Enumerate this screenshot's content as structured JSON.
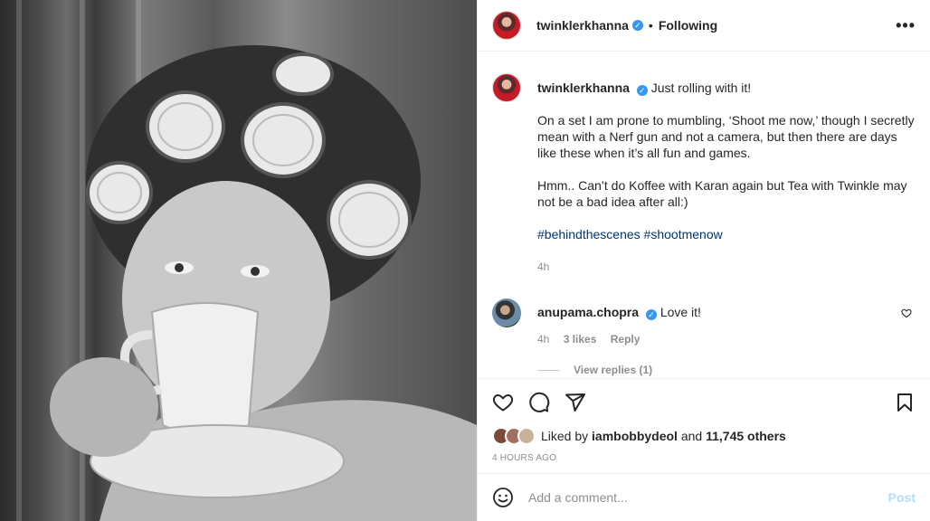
{
  "header": {
    "username": "twinklerkhanna",
    "verified_mark": "✓",
    "separator": "•",
    "follow_status": "Following",
    "more_icon": "more-horizontal-icon"
  },
  "caption": {
    "username": "twinklerkhanna",
    "verified_mark": "✓",
    "first_line": "Just rolling with it!",
    "paragraph_1": "On a set I am prone to mumbling, ‘Shoot me now,’ though I secretly mean with a Nerf gun and not a camera, but then there are days like these when it’s all fun and games.",
    "paragraph_2": "Hmm.. Can’t do Koffee with Karan again but Tea with Twinkle may not be a bad idea after all:)",
    "hashtags": [
      "#behindthescenes",
      "#shootmenow"
    ],
    "time": "4h"
  },
  "comment": {
    "username": "anupama.chopra",
    "verified_mark": "✓",
    "text": "Love it!",
    "time": "4h",
    "likes": "3 likes",
    "reply": "Reply",
    "view_replies": "View replies (1)"
  },
  "actions": {
    "like_icon": "heart-icon",
    "comment_icon": "comment-icon",
    "share_icon": "paper-plane-icon",
    "save_icon": "bookmark-icon"
  },
  "likes": {
    "prefix": "Liked by",
    "user": "iambobbydeol",
    "and": "and",
    "others": "11,745 others"
  },
  "post_time": "4 HOURS AGO",
  "add_comment": {
    "placeholder": "Add a comment...",
    "post_label": "Post"
  },
  "colors": {
    "link": "#00376b",
    "verified": "#3897f0",
    "post_disabled": "#b2dffc",
    "muted": "#8e8e8e"
  }
}
